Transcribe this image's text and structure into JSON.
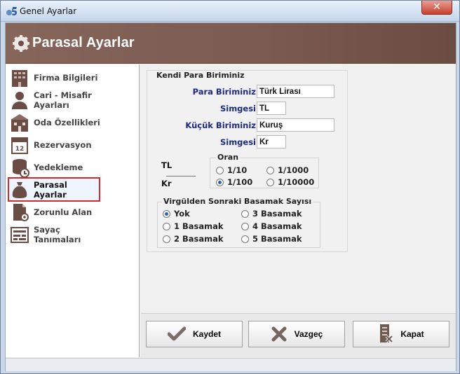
{
  "window": {
    "title": "Genel Ayarlar",
    "close_label": "✕"
  },
  "header": {
    "title": "Parasal Ayarlar"
  },
  "sidebar": {
    "items": [
      {
        "label": "Firma Bilgileri",
        "icon": "building-icon"
      },
      {
        "label": "Cari - Misafir Ayarları",
        "icon": "user-icon"
      },
      {
        "label": "Oda Özellikleri",
        "icon": "room-icon"
      },
      {
        "label": "Rezervasyon",
        "icon": "calendar-icon"
      },
      {
        "label": "Yedekleme",
        "icon": "backup-icon"
      },
      {
        "label": "Parasal Ayarlar",
        "icon": "money-bag-icon",
        "active": true
      },
      {
        "label": "Zorunlu Alan",
        "icon": "document-gear-icon"
      },
      {
        "label": "Sayaç Tanımaları",
        "icon": "counter-icon"
      }
    ]
  },
  "currency_panel": {
    "title": "Kendi Para Biriminiz",
    "currency_label": "Para Biriminiz",
    "currency_value": "Türk Lirası",
    "symbol_label": "Simgesi",
    "symbol_value": "TL",
    "sub_unit_label": "Küçük Biriminiz",
    "sub_unit_value": "Kuruş",
    "sub_symbol_label": "Simgesi",
    "sub_symbol_value": "Kr",
    "tl_label": "TL",
    "kr_label": "Kr",
    "ratio_title": "Oran",
    "ratio_options": [
      "1/10",
      "1/100",
      "1/1000",
      "1/10000"
    ],
    "ratio_selected": "1/100",
    "decimal_title": "Virgülden Sonraki Basamak Sayısı",
    "decimal_options": [
      "Yok",
      "1 Basamak",
      "2 Basamak",
      "3 Basamak",
      "4 Basamak",
      "5 Basamak"
    ],
    "decimal_selected": "Yok"
  },
  "buttons": {
    "save": "Kaydet",
    "cancel": "Vazgeç",
    "close": "Kapat"
  },
  "colors": {
    "header_brown": "#7b5b52",
    "active_border": "#d32b2b",
    "label_blue": "#1d2a8a"
  }
}
